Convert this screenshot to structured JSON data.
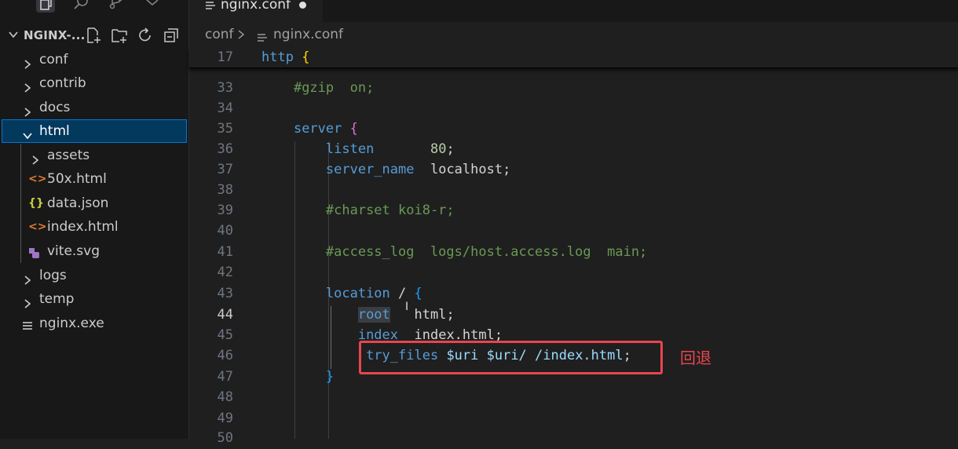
{
  "explorer": {
    "title": "NGINX-...",
    "items": [
      {
        "label": "conf",
        "kind": "folder",
        "expanded": false
      },
      {
        "label": "contrib",
        "kind": "folder",
        "expanded": false
      },
      {
        "label": "docs",
        "kind": "folder",
        "expanded": false
      },
      {
        "label": "html",
        "kind": "folder",
        "expanded": true,
        "selected": true
      },
      {
        "label": "assets",
        "kind": "folder",
        "expanded": false
      },
      {
        "label": "50x.html",
        "kind": "html-file",
        "icon": "<>"
      },
      {
        "label": "data.json",
        "kind": "json-file",
        "icon": "{}"
      },
      {
        "label": "index.html",
        "kind": "html-file",
        "icon": "<>"
      },
      {
        "label": "vite.svg",
        "kind": "svg-file"
      },
      {
        "label": "logs",
        "kind": "folder",
        "expanded": false
      },
      {
        "label": "temp",
        "kind": "folder",
        "expanded": false
      },
      {
        "label": "nginx.exe",
        "kind": "exe-file"
      }
    ]
  },
  "tab": {
    "name": "nginx.conf",
    "modified": true
  },
  "breadcrumb": {
    "folder": "conf",
    "file": "nginx.conf"
  },
  "sticky": {
    "number": "17",
    "keyword": "http",
    "brace": "{"
  },
  "lines": [
    {
      "n": "33",
      "indent": "    ",
      "comment": "#gzip  on;"
    },
    {
      "n": "34"
    },
    {
      "n": "35",
      "indent": "    ",
      "kw": "server",
      "rest": " ",
      "brace": "{"
    },
    {
      "n": "36",
      "indent": "        ",
      "kw": "listen",
      "pad": "       ",
      "val": "80",
      "end": ";"
    },
    {
      "n": "37",
      "indent": "        ",
      "kw": "server_name",
      "pad": "  ",
      "val": "localhost",
      "end": ";"
    },
    {
      "n": "38"
    },
    {
      "n": "39",
      "indent": "        ",
      "comment": "#charset koi8-r;"
    },
    {
      "n": "40"
    },
    {
      "n": "41",
      "indent": "        ",
      "comment": "#access_log  logs/host.access.log  main;"
    },
    {
      "n": "42"
    },
    {
      "n": "43",
      "indent": "        ",
      "kw": "location",
      "rest": " / ",
      "brace": "{"
    },
    {
      "n": "44",
      "indent": "            ",
      "kw": "root",
      "pad": "   ",
      "val": "html",
      "end": ";",
      "active": true
    },
    {
      "n": "45",
      "indent": "            ",
      "kw": "index",
      "pad": "  ",
      "val": "index.html",
      "end": ";"
    },
    {
      "n": "46",
      "indent": "             ",
      "kw": "try_files",
      "pad": " ",
      "val": "$uri $uri/ /index.html",
      "end": ";"
    },
    {
      "n": "47",
      "indent": "        ",
      "closebrace": "}"
    },
    {
      "n": "48"
    },
    {
      "n": "49"
    },
    {
      "n": "50"
    }
  ],
  "annotation": "回退",
  "colors": {
    "highlight_box": "#e8454f",
    "selection": "#04395e",
    "keyword": "#569cd6",
    "comment": "#6a9955"
  }
}
